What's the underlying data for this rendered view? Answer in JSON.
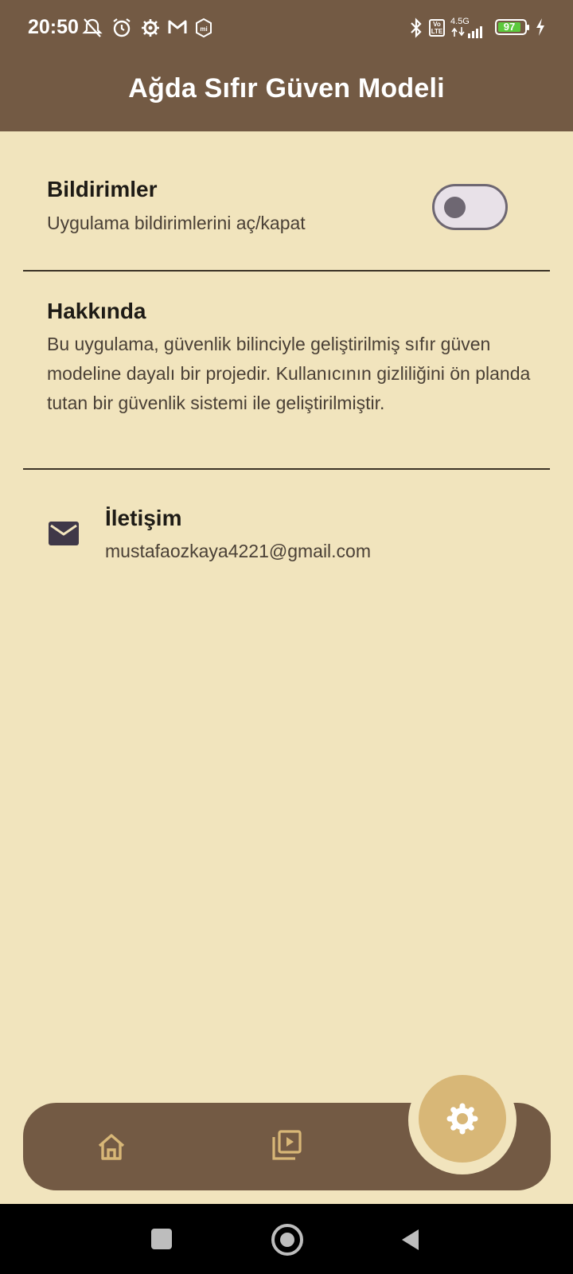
{
  "status_bar": {
    "time": "20:50",
    "network": "4.5G",
    "volte": "Vo LTE",
    "battery": "97",
    "icons": [
      "muted-alarm-icon",
      "alarm-icon",
      "settings-icon",
      "gmail-icon",
      "mi-icon",
      "bluetooth-icon",
      "signal-icon",
      "charging-icon"
    ]
  },
  "app_bar": {
    "title": "Ağda Sıfır Güven Modeli"
  },
  "notifications": {
    "title": "Bildirimler",
    "subtitle": "Uygulama bildirimlerini aç/kapat",
    "enabled": false
  },
  "about": {
    "title": "Hakkında",
    "text": "Bu uygulama, güvenlik bilinciyle geliştirilmiş sıfır güven modeline dayalı bir projedir. Kullanıcının gizliliğini ön planda tutan bir güvenlik sistemi ile geliştirilmiştir."
  },
  "contact": {
    "title": "İletişim",
    "email": "mustafaozkaya4221@gmail.com",
    "icon": "mail-icon"
  },
  "bottom_nav": {
    "items": [
      {
        "icon": "home-icon",
        "active": false
      },
      {
        "icon": "media-library-icon",
        "active": false
      },
      {
        "icon": "settings-icon",
        "active": true
      }
    ]
  },
  "colors": {
    "primary": "#735A44",
    "background": "#F1E4BD",
    "accent": "#D8B777"
  }
}
